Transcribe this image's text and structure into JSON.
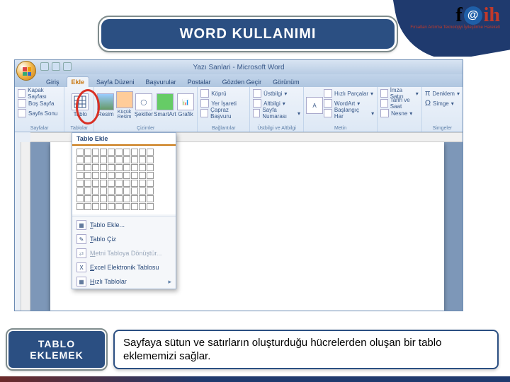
{
  "logo": {
    "sub": "Fırsatları Artırma Teknolojiyi İyileştirme Hareketi"
  },
  "slide": {
    "title": "WORD KULLANIMI",
    "footer_label_line1": "TABLO",
    "footer_label_line2": "EKLEMEK",
    "footer_desc": "Sayfaya sütun ve satırların oluşturduğu hücrelerden oluşan bir tablo eklememizi sağlar."
  },
  "word": {
    "window_title": "Yazı Sanlari - Microsoft Word",
    "tabs": [
      "Giriş",
      "Ekle",
      "Sayfa Düzeni",
      "Başvurular",
      "Postalar",
      "Gözden Geçir",
      "Görünüm"
    ],
    "active_tab": 1,
    "groups": {
      "pages": {
        "label": "Sayfalar",
        "items": [
          "Kapak Sayfası",
          "Boş Sayfa",
          "Sayfa Sonu"
        ]
      },
      "tables": {
        "label": "Tablolar",
        "big": "Tablo"
      },
      "illus": {
        "label": "Çizimler",
        "items": [
          "Resim",
          "Küçük Resim",
          "Şekiller",
          "SmartArt",
          "Grafik"
        ]
      },
      "links": {
        "label": "Bağlantılar",
        "items": [
          "Köprü",
          "Yer İşareti",
          "Çapraz Başvuru"
        ]
      },
      "headerfooter": {
        "label": "Üstbilgi ve Altbilgi",
        "items": [
          "Üstbilgi",
          "Altbilgi",
          "Sayfa Numarası"
        ]
      },
      "text": {
        "label": "Metin",
        "items": [
          "Metin Kutusu",
          "Hızlı Parçalar",
          "WordArt",
          "Başlangıç Har"
        ]
      },
      "sym": {
        "label": "Simgeler",
        "items": [
          "Denklem",
          "Simge"
        ]
      },
      "sig": {
        "items": [
          "İmza Satırı",
          "Tarih ve Saat",
          "Nesne"
        ]
      }
    },
    "dropdown": {
      "title": "Tablo Ekle",
      "items": [
        {
          "label": "Tablo Ekle...",
          "disabled": false,
          "icon": "grid"
        },
        {
          "label": "Tablo Çiz",
          "disabled": false,
          "icon": "pencil"
        },
        {
          "label": "Metni Tabloya Dönüştür...",
          "disabled": true,
          "icon": "convert"
        },
        {
          "label": "Excel Elektronik Tablosu",
          "disabled": false,
          "icon": "excel"
        },
        {
          "label": "Hızlı Tablolar",
          "disabled": false,
          "icon": "quick",
          "arrow": true
        }
      ]
    }
  }
}
